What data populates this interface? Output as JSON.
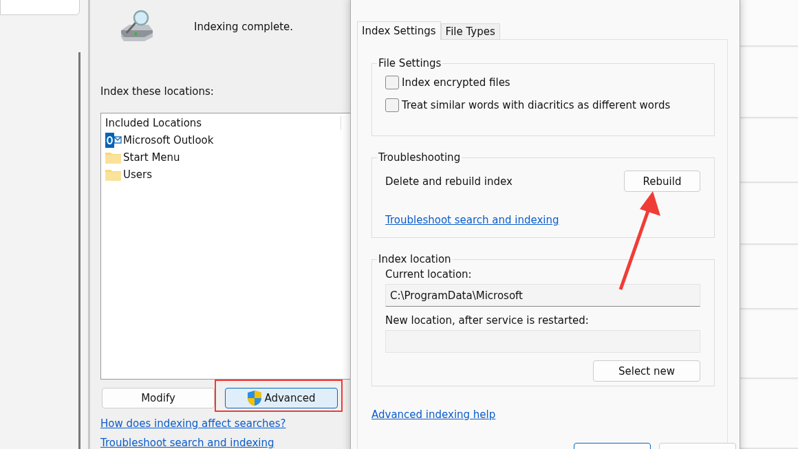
{
  "indexing_options": {
    "status": "Indexing complete.",
    "locations_label": "Index these locations:",
    "table": {
      "columns": [
        "Included Locations"
      ],
      "rows": [
        {
          "kind": "outlook",
          "cells": [
            "Microsoft Outlook"
          ]
        },
        {
          "kind": "folder",
          "cells": [
            "Start Menu"
          ]
        },
        {
          "kind": "folder",
          "cells": [
            "Users"
          ]
        }
      ]
    },
    "buttons": [
      {
        "label": "Modify",
        "shield": false,
        "highlighted": false
      },
      {
        "label": "Advanced",
        "shield": true,
        "highlighted": true
      }
    ],
    "links": [
      "How does indexing affect searches?",
      "Troubleshoot search and indexing"
    ]
  },
  "advanced_options": {
    "tabs": [
      {
        "label": "Index Settings",
        "selected": true
      },
      {
        "label": "File Types",
        "selected": false
      }
    ],
    "file_settings": {
      "title": "File Settings",
      "options": [
        {
          "label": "Index encrypted files",
          "checked": false
        },
        {
          "label": "Treat similar words with diacritics as different words",
          "checked": false
        }
      ]
    },
    "troubleshooting": {
      "title": "Troubleshooting",
      "description": "Delete and rebuild index",
      "button": "Rebuild",
      "link": "Troubleshoot search and indexing"
    },
    "index_location": {
      "title": "Index location",
      "current_label": "Current location:",
      "current_value": "C:\\ProgramData\\Microsoft",
      "new_label": "New location, after service is restarted:",
      "button": "Select new"
    },
    "help_link": "Advanced indexing help"
  }
}
